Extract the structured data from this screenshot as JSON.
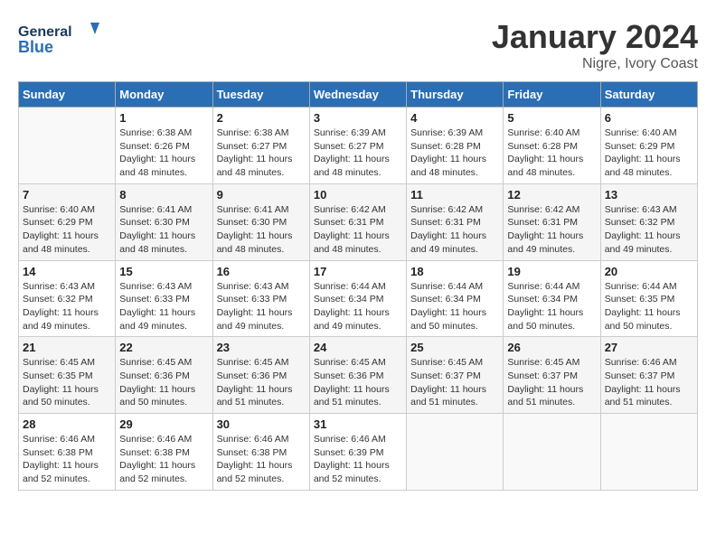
{
  "header": {
    "logo_text_general": "General",
    "logo_text_blue": "Blue",
    "title": "January 2024",
    "subtitle": "Nigre, Ivory Coast"
  },
  "calendar": {
    "days_of_week": [
      "Sunday",
      "Monday",
      "Tuesday",
      "Wednesday",
      "Thursday",
      "Friday",
      "Saturday"
    ],
    "weeks": [
      [
        {
          "day": "",
          "info": ""
        },
        {
          "day": "1",
          "info": "Sunrise: 6:38 AM\nSunset: 6:26 PM\nDaylight: 11 hours\nand 48 minutes."
        },
        {
          "day": "2",
          "info": "Sunrise: 6:38 AM\nSunset: 6:27 PM\nDaylight: 11 hours\nand 48 minutes."
        },
        {
          "day": "3",
          "info": "Sunrise: 6:39 AM\nSunset: 6:27 PM\nDaylight: 11 hours\nand 48 minutes."
        },
        {
          "day": "4",
          "info": "Sunrise: 6:39 AM\nSunset: 6:28 PM\nDaylight: 11 hours\nand 48 minutes."
        },
        {
          "day": "5",
          "info": "Sunrise: 6:40 AM\nSunset: 6:28 PM\nDaylight: 11 hours\nand 48 minutes."
        },
        {
          "day": "6",
          "info": "Sunrise: 6:40 AM\nSunset: 6:29 PM\nDaylight: 11 hours\nand 48 minutes."
        }
      ],
      [
        {
          "day": "7",
          "info": "Sunrise: 6:40 AM\nSunset: 6:29 PM\nDaylight: 11 hours\nand 48 minutes."
        },
        {
          "day": "8",
          "info": "Sunrise: 6:41 AM\nSunset: 6:30 PM\nDaylight: 11 hours\nand 48 minutes."
        },
        {
          "day": "9",
          "info": "Sunrise: 6:41 AM\nSunset: 6:30 PM\nDaylight: 11 hours\nand 48 minutes."
        },
        {
          "day": "10",
          "info": "Sunrise: 6:42 AM\nSunset: 6:31 PM\nDaylight: 11 hours\nand 48 minutes."
        },
        {
          "day": "11",
          "info": "Sunrise: 6:42 AM\nSunset: 6:31 PM\nDaylight: 11 hours\nand 49 minutes."
        },
        {
          "day": "12",
          "info": "Sunrise: 6:42 AM\nSunset: 6:31 PM\nDaylight: 11 hours\nand 49 minutes."
        },
        {
          "day": "13",
          "info": "Sunrise: 6:43 AM\nSunset: 6:32 PM\nDaylight: 11 hours\nand 49 minutes."
        }
      ],
      [
        {
          "day": "14",
          "info": "Sunrise: 6:43 AM\nSunset: 6:32 PM\nDaylight: 11 hours\nand 49 minutes."
        },
        {
          "day": "15",
          "info": "Sunrise: 6:43 AM\nSunset: 6:33 PM\nDaylight: 11 hours\nand 49 minutes."
        },
        {
          "day": "16",
          "info": "Sunrise: 6:43 AM\nSunset: 6:33 PM\nDaylight: 11 hours\nand 49 minutes."
        },
        {
          "day": "17",
          "info": "Sunrise: 6:44 AM\nSunset: 6:34 PM\nDaylight: 11 hours\nand 49 minutes."
        },
        {
          "day": "18",
          "info": "Sunrise: 6:44 AM\nSunset: 6:34 PM\nDaylight: 11 hours\nand 50 minutes."
        },
        {
          "day": "19",
          "info": "Sunrise: 6:44 AM\nSunset: 6:34 PM\nDaylight: 11 hours\nand 50 minutes."
        },
        {
          "day": "20",
          "info": "Sunrise: 6:44 AM\nSunset: 6:35 PM\nDaylight: 11 hours\nand 50 minutes."
        }
      ],
      [
        {
          "day": "21",
          "info": "Sunrise: 6:45 AM\nSunset: 6:35 PM\nDaylight: 11 hours\nand 50 minutes."
        },
        {
          "day": "22",
          "info": "Sunrise: 6:45 AM\nSunset: 6:36 PM\nDaylight: 11 hours\nand 50 minutes."
        },
        {
          "day": "23",
          "info": "Sunrise: 6:45 AM\nSunset: 6:36 PM\nDaylight: 11 hours\nand 51 minutes."
        },
        {
          "day": "24",
          "info": "Sunrise: 6:45 AM\nSunset: 6:36 PM\nDaylight: 11 hours\nand 51 minutes."
        },
        {
          "day": "25",
          "info": "Sunrise: 6:45 AM\nSunset: 6:37 PM\nDaylight: 11 hours\nand 51 minutes."
        },
        {
          "day": "26",
          "info": "Sunrise: 6:45 AM\nSunset: 6:37 PM\nDaylight: 11 hours\nand 51 minutes."
        },
        {
          "day": "27",
          "info": "Sunrise: 6:46 AM\nSunset: 6:37 PM\nDaylight: 11 hours\nand 51 minutes."
        }
      ],
      [
        {
          "day": "28",
          "info": "Sunrise: 6:46 AM\nSunset: 6:38 PM\nDaylight: 11 hours\nand 52 minutes."
        },
        {
          "day": "29",
          "info": "Sunrise: 6:46 AM\nSunset: 6:38 PM\nDaylight: 11 hours\nand 52 minutes."
        },
        {
          "day": "30",
          "info": "Sunrise: 6:46 AM\nSunset: 6:38 PM\nDaylight: 11 hours\nand 52 minutes."
        },
        {
          "day": "31",
          "info": "Sunrise: 6:46 AM\nSunset: 6:39 PM\nDaylight: 11 hours\nand 52 minutes."
        },
        {
          "day": "",
          "info": ""
        },
        {
          "day": "",
          "info": ""
        },
        {
          "day": "",
          "info": ""
        }
      ]
    ]
  }
}
